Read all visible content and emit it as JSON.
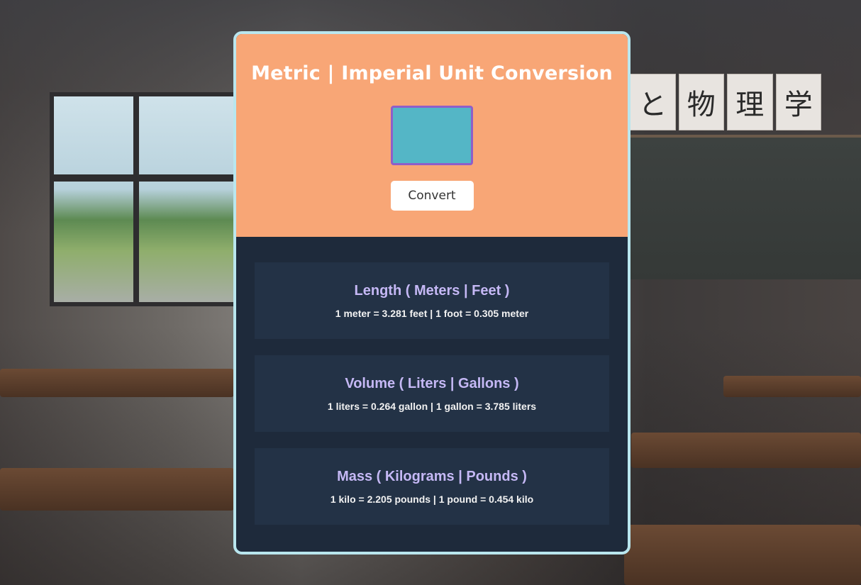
{
  "background": {
    "banner_chars": [
      "と",
      "物",
      "理",
      "学"
    ]
  },
  "header": {
    "title": "Metric | Imperial Unit Conversion"
  },
  "input": {
    "value": "",
    "placeholder": ""
  },
  "convert_button": {
    "label": "Convert"
  },
  "conversions": [
    {
      "title": "Length ( Meters | Feet )",
      "detail": "1 meter = 3.281 feet | 1 foot = 0.305 meter"
    },
    {
      "title": "Volume ( Liters | Gallons )",
      "detail": "1 liters = 0.264 gallon | 1 gallon = 3.785 liters"
    },
    {
      "title": "Mass ( Kilograms | Pounds )",
      "detail": "1 kilo = 2.205 pounds | 1 pound = 0.454 kilo"
    }
  ],
  "colors": {
    "header_bg": "#f8a676",
    "card_border": "#b9e6ee",
    "input_bg": "#54b6c6",
    "input_border": "#8f5ec9",
    "panel_bg": "#1e2a3b",
    "box_bg": "#233246",
    "box_title": "#c5b8f5"
  }
}
